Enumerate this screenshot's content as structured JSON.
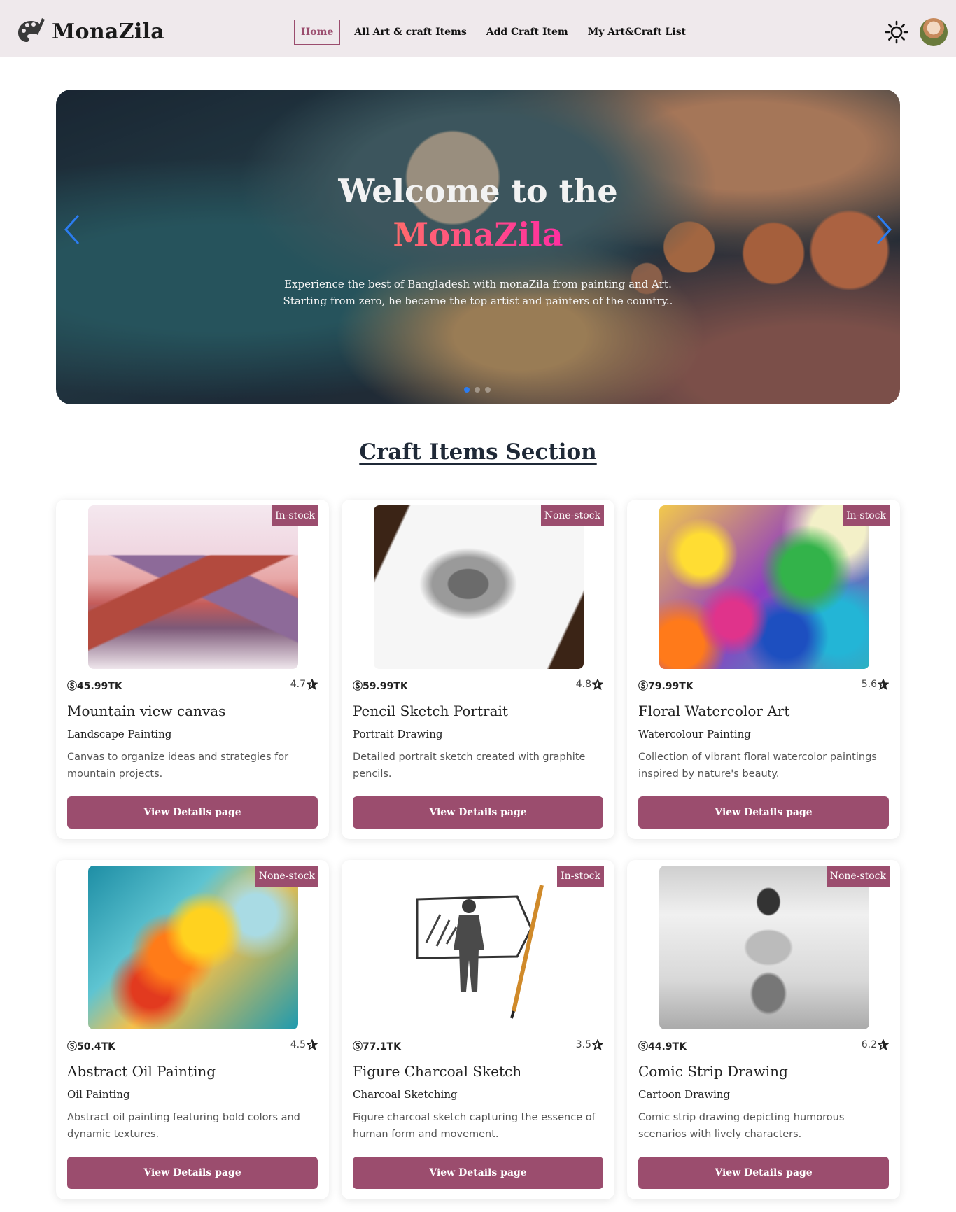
{
  "brand": {
    "name": "MonaZila"
  },
  "nav": {
    "links": [
      "Home",
      "All Art & craft Items",
      "Add Craft Item",
      "My Art&Craft List"
    ],
    "active": "Home"
  },
  "header_icons": {
    "theme": "sun-icon",
    "avatar": "user-avatar"
  },
  "hero": {
    "title": "Welcome to the",
    "brand": "MonaZila",
    "text": "Experience the best of Bangladesh with monaZila from painting and Art. Starting from zero, he became the top artist and painters of the country..",
    "slides": 3,
    "active_slide": 1
  },
  "section": {
    "title": "Craft Items Section"
  },
  "cards": [
    {
      "badge": "In-stock",
      "price": "Ⓢ45.99TK",
      "rating": "4.7",
      "title": "Mountain view canvas",
      "subcategory": "Landscape Painting",
      "description": "Canvas to organize ideas and strategies for mountain projects.",
      "button": "View Details page",
      "image": "mountain-watercolor"
    },
    {
      "badge": "None-stock",
      "price": "Ⓢ59.99TK",
      "rating": "4.8",
      "title": "Pencil Sketch Portrait",
      "subcategory": "Portrait Drawing",
      "description": "Detailed portrait sketch created with graphite pencils.",
      "button": "View Details page",
      "image": "tiger-sketch"
    },
    {
      "badge": "In-stock",
      "price": "Ⓢ79.99TK",
      "rating": "5.6",
      "title": "Floral Watercolor Art",
      "subcategory": "Watercolour Painting",
      "description": "Collection of vibrant floral watercolor paintings inspired by nature's beauty.",
      "button": "View Details page",
      "image": "floral-watercolor"
    },
    {
      "badge": "None-stock",
      "price": "Ⓢ50.4TK",
      "rating": "4.5",
      "title": "Abstract Oil Painting",
      "subcategory": "Oil Painting",
      "description": "Abstract oil painting featuring bold colors and dynamic textures.",
      "button": "View Details page",
      "image": "abstract-oil"
    },
    {
      "badge": "In-stock",
      "price": "Ⓢ77.1TK",
      "rating": "3.5",
      "title": "Figure Charcoal Sketch",
      "subcategory": "Charcoal Sketching",
      "description": "Figure charcoal sketch capturing the essence of human form and movement.",
      "button": "View Details page",
      "image": "figure-pencil"
    },
    {
      "badge": "None-stock",
      "price": "Ⓢ44.9TK",
      "rating": "6.2",
      "title": "Comic Strip Drawing",
      "subcategory": "Cartoon Drawing",
      "description": "Comic strip drawing depicting humorous scenarios with lively characters.",
      "button": "View Details page",
      "image": "comic-skater"
    }
  ],
  "colors": {
    "accent": "#9b4d6e",
    "navbar_bg": "#efe9ec",
    "carousel_dot_active": "#2b7cf0"
  }
}
